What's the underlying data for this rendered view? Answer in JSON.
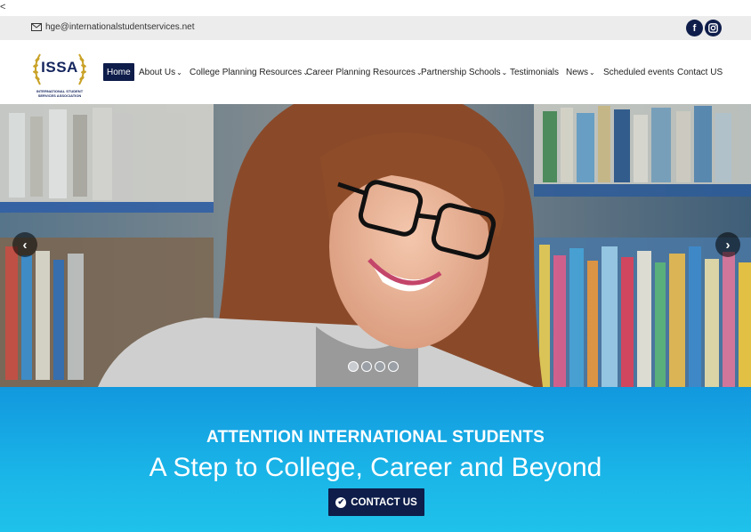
{
  "corner_text": "<",
  "topbar": {
    "email": "hge@internationalstudentservices.net",
    "social": [
      {
        "name": "facebook-icon",
        "glyph": "f"
      },
      {
        "name": "instagram-icon",
        "glyph": "◎"
      }
    ]
  },
  "logo": {
    "text": "ISSA",
    "subtitle": "INTERNATIONAL STUDENT SERVICES ASSOCIATION"
  },
  "nav": {
    "items": [
      {
        "label": "Home",
        "active": true,
        "dropdown": false
      },
      {
        "label": "About Us",
        "active": false,
        "dropdown": true
      },
      {
        "label": "College Planning Resources",
        "active": false,
        "dropdown": true
      },
      {
        "label": "Career Planning Resources",
        "active": false,
        "dropdown": true
      },
      {
        "label": "Partnership Schools",
        "active": false,
        "dropdown": true
      },
      {
        "label": "Testimonials",
        "active": false,
        "dropdown": false
      },
      {
        "label": "News",
        "active": false,
        "dropdown": true
      },
      {
        "label": "Scheduled events",
        "active": false,
        "dropdown": false
      },
      {
        "label": "Contact US",
        "active": false,
        "dropdown": false
      }
    ]
  },
  "slider": {
    "slide_count": 4,
    "active_index": 0
  },
  "band": {
    "heading": "ATTENTION INTERNATIONAL STUDENTS",
    "tagline": "A Step to College, Career and Beyond",
    "cta_label": "CONTACT US"
  },
  "colors": {
    "navy": "#0e1d4a",
    "band_top": "#1298de",
    "band_bottom": "#1fc2ea",
    "topbar": "#ececec"
  }
}
